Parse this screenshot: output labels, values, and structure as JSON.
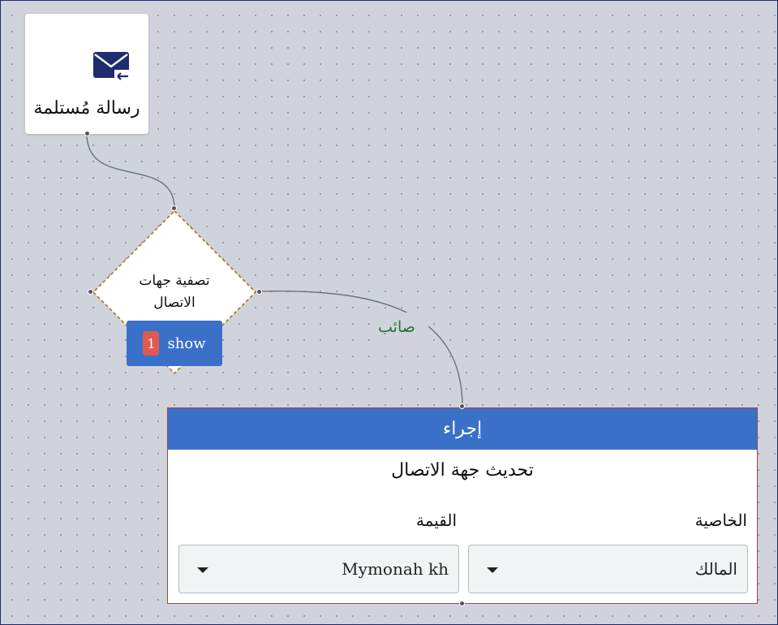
{
  "trigger": {
    "label": "رسالة مُستلمة",
    "icon": "mail-received-icon"
  },
  "filter": {
    "label": "تصفية جهات الاتصال",
    "show_label": "show",
    "count": "1"
  },
  "edge": {
    "label": "صائب"
  },
  "action": {
    "header": "إجراء",
    "title": "تحديث جهة الاتصال",
    "property": {
      "label": "الخاصية",
      "value": "المالك"
    },
    "value": {
      "label": "القيمة",
      "value": "Mymonah kh"
    }
  },
  "colors": {
    "accent": "#3b70c8",
    "badge": "#e05a52",
    "edge_label": "#2c6e3c",
    "canvas": "#d0d3dc"
  }
}
